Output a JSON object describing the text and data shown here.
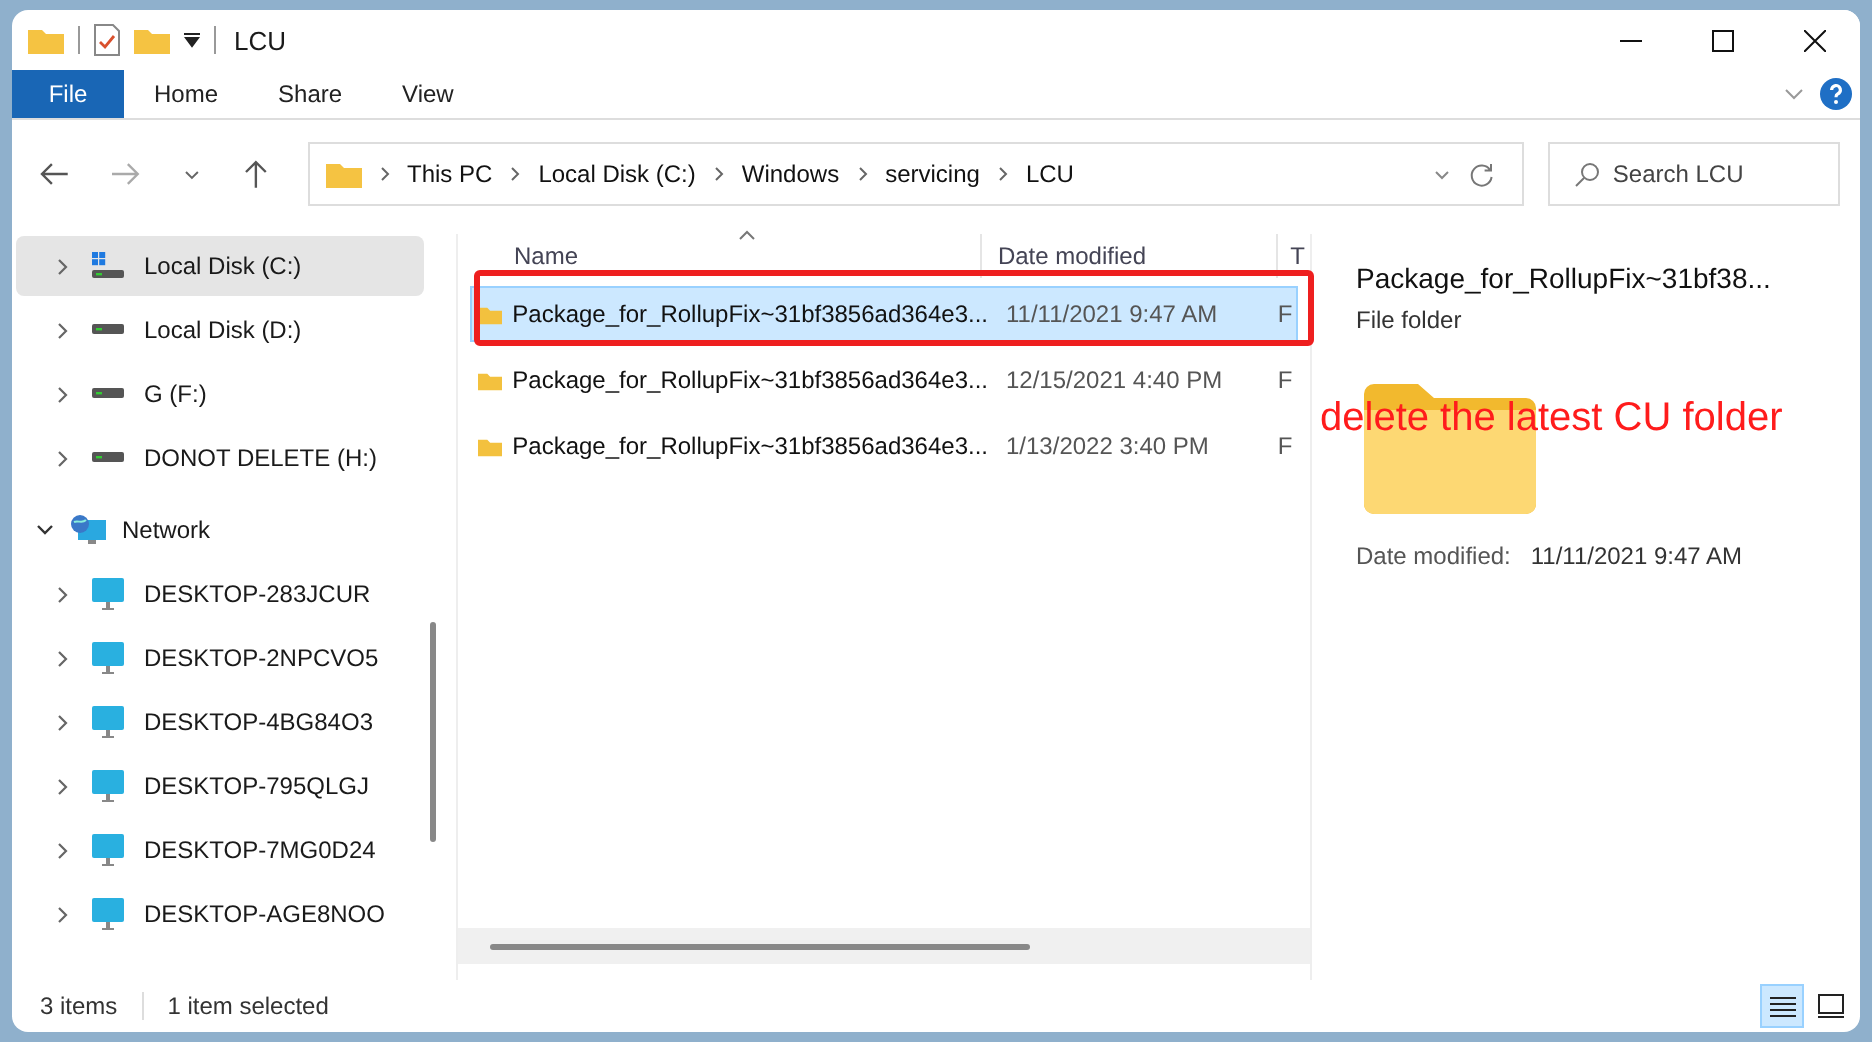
{
  "window": {
    "title": "LCU"
  },
  "ribbon_tabs": [
    {
      "label": "File",
      "selected": true
    },
    {
      "label": "Home",
      "selected": false
    },
    {
      "label": "Share",
      "selected": false
    },
    {
      "label": "View",
      "selected": false
    }
  ],
  "address": {
    "crumbs": [
      "This PC",
      "Local Disk (C:)",
      "Windows",
      "servicing",
      "LCU"
    ]
  },
  "search": {
    "placeholder": "Search LCU"
  },
  "nav": [
    {
      "label": "Local Disk (C:)",
      "kind": "system-drive",
      "expanded": false,
      "selected": true
    },
    {
      "label": "Local Disk (D:)",
      "kind": "drive",
      "expanded": false,
      "selected": false
    },
    {
      "label": "G (F:)",
      "kind": "drive",
      "expanded": false,
      "selected": false
    },
    {
      "label": "DONOT DELETE (H:)",
      "kind": "drive",
      "expanded": false,
      "selected": false
    },
    {
      "label": "Network",
      "kind": "network",
      "expanded": true,
      "selected": false
    },
    {
      "label": "DESKTOP-283JCUR",
      "kind": "computer",
      "expanded": false,
      "selected": false
    },
    {
      "label": "DESKTOP-2NPCVO5",
      "kind": "computer",
      "expanded": false,
      "selected": false
    },
    {
      "label": "DESKTOP-4BG84O3",
      "kind": "computer",
      "expanded": false,
      "selected": false
    },
    {
      "label": "DESKTOP-795QLGJ",
      "kind": "computer",
      "expanded": false,
      "selected": false
    },
    {
      "label": "DESKTOP-7MG0D24",
      "kind": "computer",
      "expanded": false,
      "selected": false
    },
    {
      "label": "DESKTOP-AGE8NOO",
      "kind": "computer",
      "expanded": false,
      "selected": false
    }
  ],
  "columns": [
    "Name",
    "Date modified",
    "T"
  ],
  "rows": [
    {
      "name": "Package_for_RollupFix~31bf3856ad364e3...",
      "date": "11/11/2021 9:47 AM",
      "column_3": "F",
      "selected": true
    },
    {
      "name": "Package_for_RollupFix~31bf3856ad364e3...",
      "date": "12/15/2021 4:40 PM",
      "column_3": "F",
      "selected": false
    },
    {
      "name": "Package_for_RollupFix~31bf3856ad364e3...",
      "date": "1/13/2022 3:40 PM",
      "column_3": "F",
      "selected": false
    }
  ],
  "details": {
    "name": "Package_for_RollupFix~31bf38...",
    "type": "File folder",
    "date_label": "Date modified:",
    "date": "11/11/2021 9:47 AM"
  },
  "annotation": {
    "text": "delete the latest CU folder"
  },
  "status_bar": {
    "count": "3 items",
    "selection": "1 item selected"
  },
  "view_buttons": [
    {
      "kind": "details",
      "selected": true
    },
    {
      "kind": "tiles",
      "selected": false
    }
  ]
}
